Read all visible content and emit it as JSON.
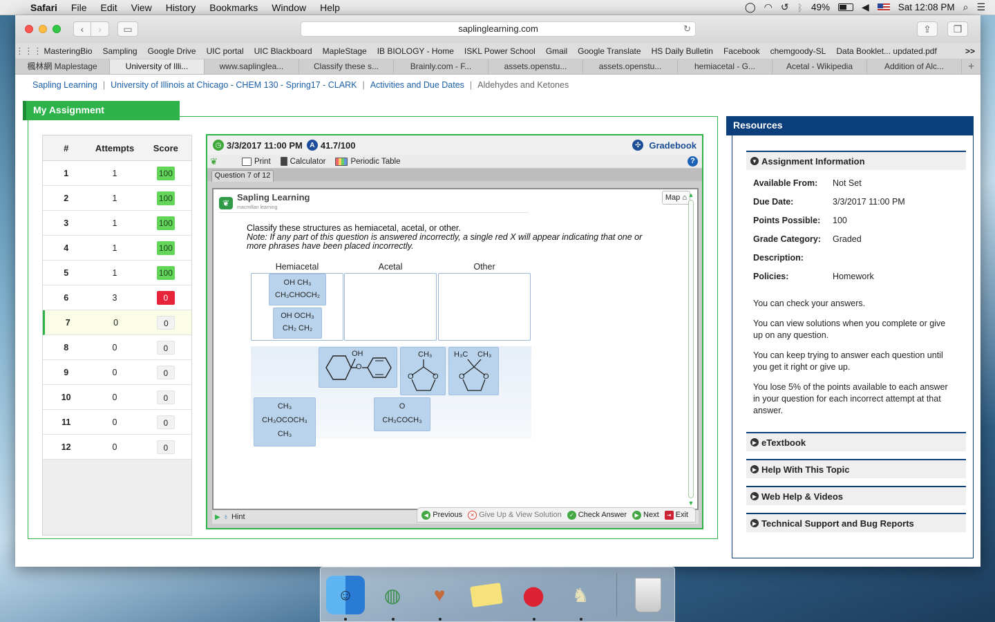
{
  "menubar": {
    "app": "Safari",
    "items": [
      "File",
      "Edit",
      "View",
      "History",
      "Bookmarks",
      "Window",
      "Help"
    ],
    "battery": "49%",
    "clock": "Sat 12:08 PM"
  },
  "browser": {
    "url": "saplinglearning.com",
    "favorites": [
      "MasteringBio",
      "Sampling",
      "Google Drive",
      "UIC portal",
      "UIC Blackboard",
      "MapleStage",
      "IB BIOLOGY - Home",
      "ISKL Power School",
      "Gmail",
      "Google Translate",
      "HS Daily Bulletin",
      "Facebook",
      "chemgoody-SL",
      "Data Booklet... updated.pdf"
    ],
    "favorites_more": ">>",
    "tabs": [
      "楓林網 Maplestage",
      "University of Illi...",
      "www.saplinglea...",
      "Classify these s...",
      "Brainly.com - F...",
      "assets.openstu...",
      "assets.openstu...",
      "hemiacetal - G...",
      "Acetal - Wikipedia",
      "Addition of Alc..."
    ],
    "active_tab": 1,
    "new_tab": "+"
  },
  "breadcrumb": {
    "items": [
      "Sapling Learning",
      "University of Illinois at Chicago - CHEM 130 - Spring17 - CLARK",
      "Activities and Due Dates"
    ],
    "current": "Aldehydes and Ketones",
    "sep": "|"
  },
  "assignment": {
    "title": "My Assignment",
    "columns": [
      "#",
      "Attempts",
      "Score"
    ],
    "rows": [
      {
        "n": "1",
        "attempts": "1",
        "score": "100"
      },
      {
        "n": "2",
        "attempts": "1",
        "score": "100"
      },
      {
        "n": "3",
        "attempts": "1",
        "score": "100"
      },
      {
        "n": "4",
        "attempts": "1",
        "score": "100"
      },
      {
        "n": "5",
        "attempts": "1",
        "score": "100"
      },
      {
        "n": "6",
        "attempts": "3",
        "score": "0"
      },
      {
        "n": "7",
        "attempts": "0",
        "score": "0"
      },
      {
        "n": "8",
        "attempts": "0",
        "score": "0"
      },
      {
        "n": "9",
        "attempts": "0",
        "score": "0"
      },
      {
        "n": "10",
        "attempts": "0",
        "score": "0"
      },
      {
        "n": "11",
        "attempts": "0",
        "score": "0"
      },
      {
        "n": "12",
        "attempts": "0",
        "score": "0"
      }
    ],
    "current_row": 6
  },
  "question": {
    "due": "3/3/2017 11:00 PM",
    "grade": "41.7/100",
    "gradebook": "Gradebook",
    "tools": {
      "print": "Print",
      "calculator": "Calculator",
      "periodic": "Periodic Table",
      "help": "?"
    },
    "tab": "Question 7 of 12",
    "logo": "Sapling Learning",
    "logo_sub": "macmillan learning",
    "map": "Map",
    "prompt": "Classify these structures as hemiacetal, acetal, or other.",
    "note": "Note: If any part of this question is answered incorrectly, a single red X will appear indicating that one or more phrases have been placed incorrectly.",
    "bins": [
      "Hemiacetal",
      "Acetal",
      "Other"
    ],
    "tile_hemi_1": {
      "l1": "OH   CH₃",
      "l2": "CH₃CHOCH₂"
    },
    "tile_hemi_2": {
      "l1": "OH   OCH₃",
      "l2": "CH₂ CH₂"
    },
    "tile_oh": "OH",
    "tile_o": "O",
    "tile_ch3": "CH₃",
    "tile_h3c": "H₃C",
    "tile_tbu": {
      "l1": "CH₃",
      "l2": "CH₃OCOCH₃",
      "l3": "CH₃"
    },
    "tile_ketone": {
      "l1": "O",
      "l2": "CH₃COCH₃"
    },
    "hint": "Hint",
    "footer": {
      "previous": "Previous",
      "giveup": "Give Up & View Solution",
      "check": "Check Answer",
      "next": "Next",
      "exit": "Exit"
    }
  },
  "resources": {
    "title": "Resources",
    "info_title": "Assignment Information",
    "fields": [
      {
        "k": "Available From:",
        "v": "Not Set"
      },
      {
        "k": "Due Date:",
        "v": "3/3/2017 11:00 PM"
      },
      {
        "k": "Points Possible:",
        "v": "100"
      },
      {
        "k": "Grade Category:",
        "v": "Graded"
      },
      {
        "k": "Description:",
        "v": ""
      },
      {
        "k": "Policies:",
        "v": "Homework"
      }
    ],
    "policies": [
      "You can check your answers.",
      "You can view solutions when you complete or give up on any question.",
      "You can keep trying to answer each question until you get it right or give up.",
      "You lose 5% of the points available to each answer in your question for each incorrect attempt at that answer."
    ],
    "sections": [
      "eTextbook",
      "Help With This Topic",
      "Web Help & Videos",
      "Technical Support and Bug Reports"
    ]
  },
  "colors": {
    "sapling_green": "#2db34a",
    "resources_blue": "#0b3f7c",
    "score_full": "#63d65a",
    "score_zero_red": "#e8243b"
  }
}
